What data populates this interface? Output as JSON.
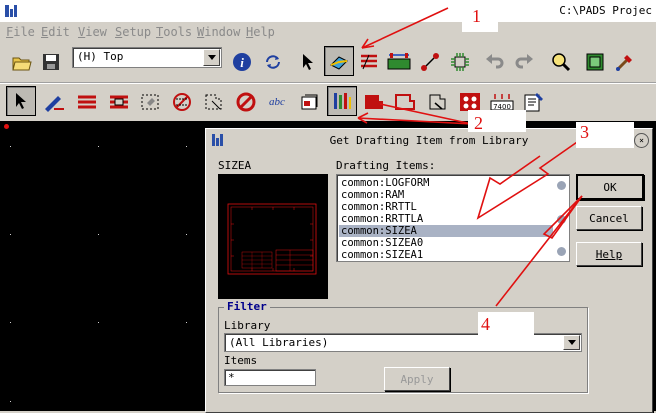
{
  "window": {
    "title": "C:\\PADS Projec"
  },
  "menu": [
    {
      "label": "File",
      "key": "F"
    },
    {
      "label": "Edit",
      "key": "E"
    },
    {
      "label": "View",
      "key": "V"
    },
    {
      "label": "Setup",
      "key": "S"
    },
    {
      "label": "Tools",
      "key": "T"
    },
    {
      "label": "Window",
      "key": "W"
    },
    {
      "label": "Help",
      "key": "H"
    }
  ],
  "toolbar": {
    "layer_value": "(H) Top",
    "icons1": [
      "open-icon",
      "save-icon",
      "info-icon",
      "refresh-icon",
      "select-icon",
      "drafting-toolbar-icon",
      "design-toolbar-icon",
      "dimension-toolbar-icon",
      "eco-toolbar-icon",
      "bga-toolbar-icon",
      "undo-icon",
      "redo-icon",
      "zoom-icon",
      "board-icon",
      "settings-icon"
    ],
    "icons2": [
      "select-mode-icon",
      "modeless-icon",
      "copper-icon",
      "copper-cutout-icon",
      "board-outline-icon",
      "keepout-icon",
      "hatch-icon",
      "prohibit-icon",
      "text-icon",
      "from-library-icon",
      "drafting-item-icon",
      "copper-pour-icon",
      "plane-area-icon",
      "auto-dimension-icon",
      "bond-icon",
      "label-icon"
    ]
  },
  "dialog": {
    "title": "Get Drafting Item from Library",
    "preview_label": "SIZEA",
    "items_label": "Drafting Items:",
    "items": [
      "common:LOGFORM",
      "common:RAM",
      "common:RRTTL",
      "common:RRTTLA",
      "common:SIZEA",
      "common:SIZEA0",
      "common:SIZEA1"
    ],
    "selected_index": 4,
    "ok_label": "OK",
    "cancel_label": "Cancel",
    "help_label": "Help",
    "filter_label": "Filter",
    "library_label": "Library",
    "library_value": "(All Libraries)",
    "items_field_label": "Items",
    "items_field_value": "*",
    "apply_label": "Apply"
  },
  "annotations": {
    "a1": "1",
    "a2": "2",
    "a3": "3",
    "a4": "4"
  },
  "colors": {
    "annotation": "#e01010",
    "selection": "#a9b2c4",
    "canvas": "#000000",
    "filter_title": "#00008b"
  }
}
